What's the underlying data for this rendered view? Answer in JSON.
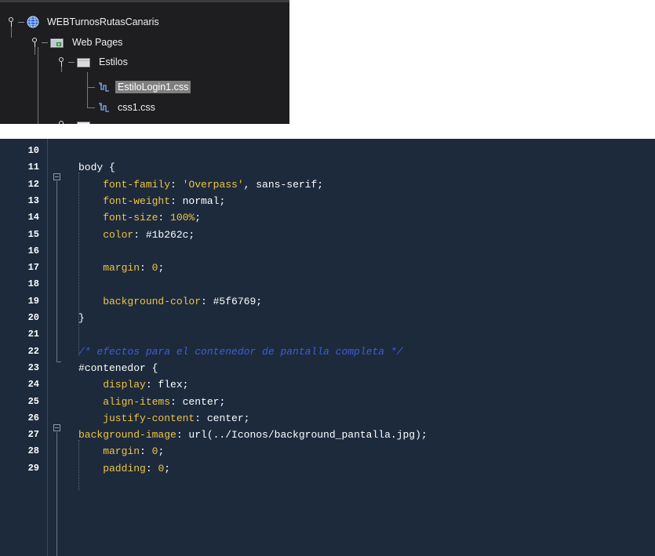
{
  "tree": {
    "items": [
      {
        "label": "WEBTurnosRutasCanaris",
        "icon": "globe-project-icon",
        "level": 0
      },
      {
        "label": "Web Pages",
        "icon": "web-folder-icon",
        "level": 1
      },
      {
        "label": "Estilos",
        "icon": "folder-icon",
        "level": 2
      },
      {
        "label": "EstiloLogin1.css",
        "icon": "css-file-icon",
        "level": 3,
        "selected": true
      },
      {
        "label": "css1.css",
        "icon": "css-file-icon",
        "level": 3
      }
    ]
  },
  "editor": {
    "colors": {
      "background": "#1c2a3c",
      "selector": "#ffffff",
      "property": "#f2c442",
      "comment": "#3d5fd6",
      "line_number": "#ffffff"
    },
    "lines": [
      {
        "num": "10",
        "tokens": []
      },
      {
        "num": "11",
        "tokens": [
          {
            "t": "body {",
            "c": "sel-c"
          }
        ]
      },
      {
        "num": "12",
        "tokens": [
          {
            "t": "    font-family",
            "c": "prop"
          },
          {
            "t": ": ",
            "c": "punc"
          },
          {
            "t": "'Overpass'",
            "c": "str"
          },
          {
            "t": ", sans-serif;",
            "c": "val"
          }
        ]
      },
      {
        "num": "13",
        "tokens": [
          {
            "t": "    font-weight",
            "c": "prop"
          },
          {
            "t": ": normal;",
            "c": "val"
          }
        ]
      },
      {
        "num": "14",
        "tokens": [
          {
            "t": "    font-size",
            "c": "prop"
          },
          {
            "t": ": ",
            "c": "punc"
          },
          {
            "t": "100%",
            "c": "num"
          },
          {
            "t": ";",
            "c": "punc"
          }
        ]
      },
      {
        "num": "15",
        "tokens": [
          {
            "t": "    color",
            "c": "prop"
          },
          {
            "t": ": #1b262c;",
            "c": "val"
          }
        ]
      },
      {
        "num": "16",
        "tokens": []
      },
      {
        "num": "17",
        "tokens": [
          {
            "t": "    margin",
            "c": "prop"
          },
          {
            "t": ": ",
            "c": "punc"
          },
          {
            "t": "0",
            "c": "num"
          },
          {
            "t": ";",
            "c": "punc"
          }
        ]
      },
      {
        "num": "18",
        "tokens": []
      },
      {
        "num": "19",
        "tokens": [
          {
            "t": "    background-color",
            "c": "prop"
          },
          {
            "t": ": #5f6769;",
            "c": "val"
          }
        ]
      },
      {
        "num": "20",
        "tokens": [
          {
            "t": "}",
            "c": "sel-c"
          }
        ]
      },
      {
        "num": "21",
        "tokens": []
      },
      {
        "num": "22",
        "tokens": [
          {
            "t": "/* efectos para el contenedor de pantalla completa */",
            "c": "cmt"
          }
        ]
      },
      {
        "num": "23",
        "tokens": [
          {
            "t": "#contenedor {",
            "c": "sel-c"
          }
        ]
      },
      {
        "num": "24",
        "tokens": [
          {
            "t": "    display",
            "c": "prop"
          },
          {
            "t": ": flex;",
            "c": "val"
          }
        ]
      },
      {
        "num": "25",
        "tokens": [
          {
            "t": "    align-items",
            "c": "prop"
          },
          {
            "t": ": center;",
            "c": "val"
          }
        ]
      },
      {
        "num": "26",
        "tokens": [
          {
            "t": "    justify-content",
            "c": "prop"
          },
          {
            "t": ": center;",
            "c": "val"
          }
        ]
      },
      {
        "num": "27",
        "tokens": [
          {
            "t": "background-image",
            "c": "prop"
          },
          {
            "t": ": url(../Iconos/background_pantalla.jpg);",
            "c": "val"
          }
        ]
      },
      {
        "num": "28",
        "tokens": [
          {
            "t": "    margin",
            "c": "prop"
          },
          {
            "t": ": ",
            "c": "punc"
          },
          {
            "t": "0",
            "c": "num"
          },
          {
            "t": ";",
            "c": "punc"
          }
        ]
      },
      {
        "num": "29",
        "tokens": [
          {
            "t": "    padding",
            "c": "prop"
          },
          {
            "t": ": ",
            "c": "punc"
          },
          {
            "t": "0",
            "c": "num"
          },
          {
            "t": ";",
            "c": "punc"
          }
        ]
      }
    ]
  }
}
